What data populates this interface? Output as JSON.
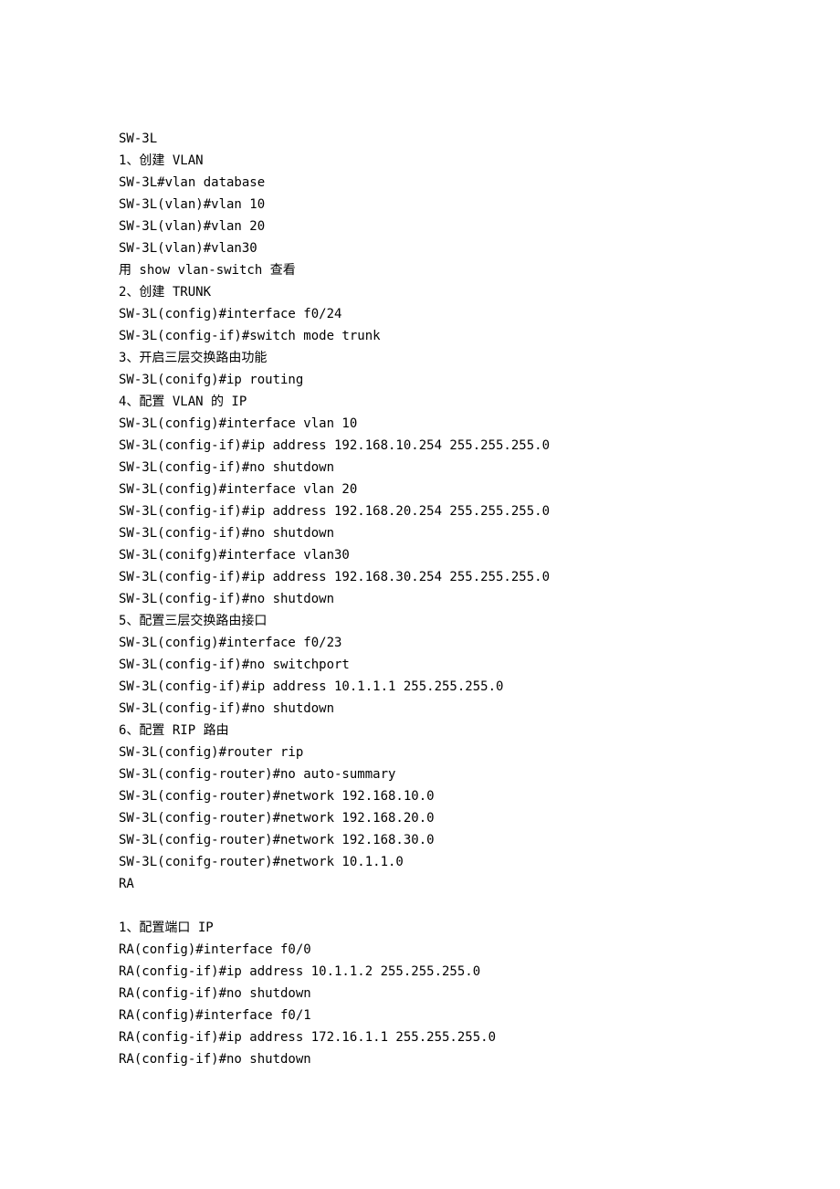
{
  "lines": [
    "SW-3L",
    "1、创建 VLAN",
    "SW-3L#vlan database",
    "SW-3L(vlan)#vlan 10",
    "SW-3L(vlan)#vlan 20",
    "SW-3L(vlan)#vlan30",
    "用 show vlan-switch 查看",
    "2、创建 TRUNK",
    "SW-3L(config)#interface f0/24",
    "SW-3L(config-if)#switch mode trunk",
    "3、开启三层交换路由功能",
    "SW-3L(conifg)#ip routing",
    "4、配置 VLAN 的 IP",
    "SW-3L(config)#interface vlan 10",
    "SW-3L(config-if)#ip address 192.168.10.254 255.255.255.0",
    "SW-3L(config-if)#no shutdown",
    "SW-3L(config)#interface vlan 20",
    "SW-3L(config-if)#ip address 192.168.20.254 255.255.255.0",
    "SW-3L(config-if)#no shutdown",
    "SW-3L(conifg)#interface vlan30",
    "SW-3L(config-if)#ip address 192.168.30.254 255.255.255.0",
    "SW-3L(config-if)#no shutdown",
    "5、配置三层交换路由接口",
    "SW-3L(config)#interface f0/23",
    "SW-3L(config-if)#no switchport",
    "SW-3L(config-if)#ip address 10.1.1.1 255.255.255.0",
    "SW-3L(config-if)#no shutdown",
    "6、配置 RIP 路由",
    "SW-3L(config)#router rip",
    "SW-3L(config-router)#no auto-summary",
    "SW-3L(config-router)#network 192.168.10.0",
    "SW-3L(config-router)#network 192.168.20.0",
    "SW-3L(config-router)#network 192.168.30.0",
    "SW-3L(conifg-router)#network 10.1.1.0",
    "RA",
    "",
    "1、配置端口 IP",
    "RA(config)#interface f0/0",
    "RA(config-if)#ip address 10.1.1.2 255.255.255.0",
    "RA(config-if)#no shutdown",
    "RA(config)#interface f0/1",
    "RA(config-if)#ip address 172.16.1.1 255.255.255.0",
    "RA(config-if)#no shutdown"
  ]
}
